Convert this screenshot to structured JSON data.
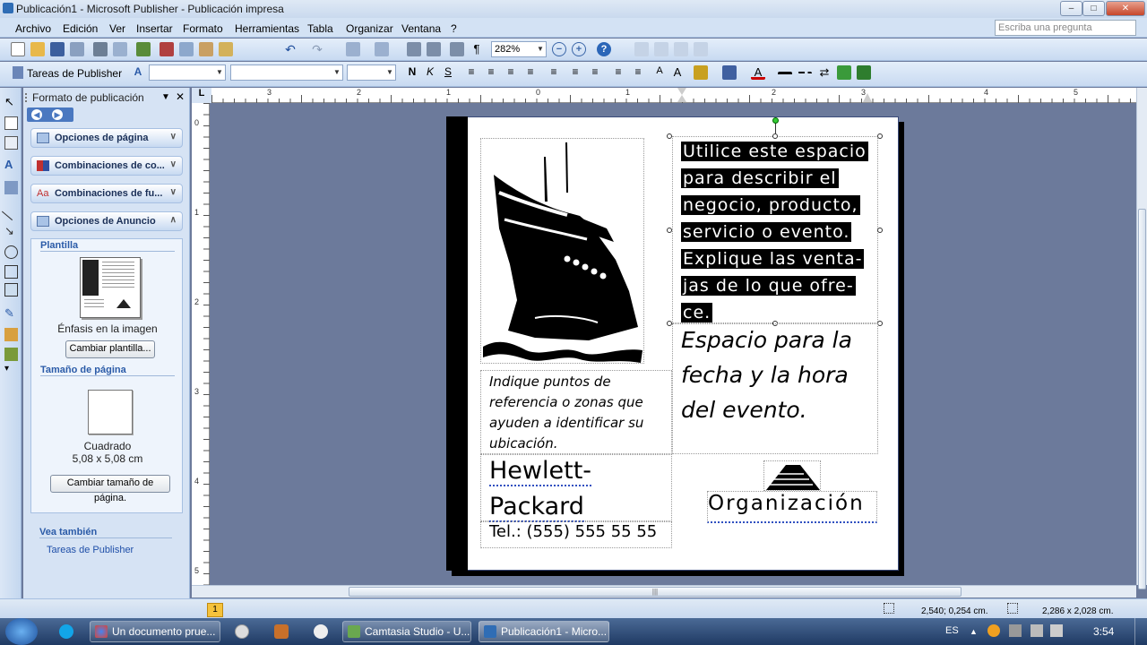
{
  "window": {
    "title": "Publicación1 - Microsoft Publisher - Publicación impresa"
  },
  "menu": {
    "items": [
      "Archivo",
      "Edición",
      "Ver",
      "Insertar",
      "Formato",
      "Herramientas",
      "Tabla",
      "Organizar",
      "Ventana",
      "?"
    ],
    "ask_placeholder": "Escriba una pregunta"
  },
  "standard_toolbar": {
    "zoom": "282%"
  },
  "formatting_toolbar": {
    "tasks_label": "Tareas de Publisher"
  },
  "taskpane": {
    "title": "Formato de publicación",
    "sections": [
      "Opciones de página",
      "Combinaciones de co...",
      "Combinaciones de fu...",
      "Opciones de Anuncio"
    ],
    "template_heading": "Plantilla",
    "template_name": "Énfasis en la imagen",
    "change_template_button": "Cambiar plantilla...",
    "page_size_heading": "Tamaño de página",
    "page_size_name": "Cuadrado",
    "page_size_value": "5,08 x 5,08 cm",
    "change_page_size_button": "Cambiar tamaño de página.",
    "see_also_heading": "Vea también",
    "see_also_link": "Tareas de Publisher"
  },
  "rulers": {
    "horizontal_labels": [
      "3",
      "2",
      "1",
      "0",
      "1",
      "2",
      "3",
      "4",
      "5"
    ],
    "vertical_labels": [
      "0",
      "1",
      "2",
      "3",
      "4",
      "5"
    ],
    "corner": "L"
  },
  "page": {
    "description_lines": [
      "Utilice este espacio",
      "para describir el",
      "negocio, producto,",
      "servicio o evento.",
      "Explique las venta-",
      "jas de lo que ofre-",
      "ce."
    ],
    "date_lines": [
      "Espacio para la",
      "fecha y la hora",
      "del evento."
    ],
    "location_lines": [
      "Indique puntos de",
      "referencia o zonas que",
      "ayuden a identificar su",
      "ubicación."
    ],
    "company_lines": [
      "Hewlett-",
      "Packard"
    ],
    "phone": "Tel.: (555) 555 55 55",
    "organization": "Organización"
  },
  "status": {
    "page_number": "1",
    "position": "2,540; 0,254 cm.",
    "size": "2,286 x 2,028 cm."
  },
  "taskbar": {
    "tasks": [
      "Un documento prue...",
      "Camtasia Studio - U...",
      "Publicación1 - Micro..."
    ],
    "lang": "ES",
    "time": "3:54"
  },
  "colors": {
    "accent": "#2b5ba8",
    "workspace": "#6c7a9b",
    "selection": "#000000"
  }
}
